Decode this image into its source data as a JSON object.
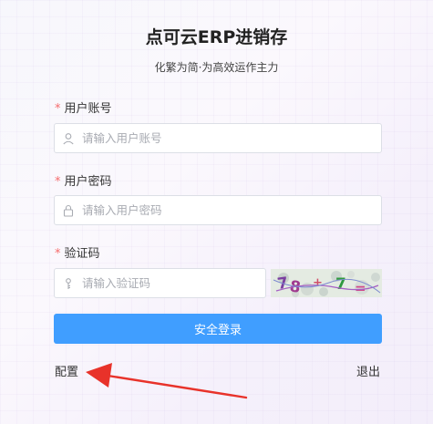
{
  "header": {
    "title": "点可云ERP进销存",
    "subtitle": "化繁为简·为高效运作主力"
  },
  "form": {
    "username": {
      "label": "用户账号",
      "placeholder": "请输入用户账号",
      "value": ""
    },
    "password": {
      "label": "用户密码",
      "placeholder": "请输入用户密码",
      "value": ""
    },
    "captcha": {
      "label": "验证码",
      "placeholder": "请输入验证码",
      "value": "",
      "image_text": "78+7="
    },
    "required_mark": "*"
  },
  "actions": {
    "login_label": "安全登录",
    "config_label": "配置",
    "logout_label": "退出"
  },
  "colors": {
    "primary": "#409eff",
    "required": "#f56c6c",
    "annotation_arrow": "#e8322a"
  }
}
